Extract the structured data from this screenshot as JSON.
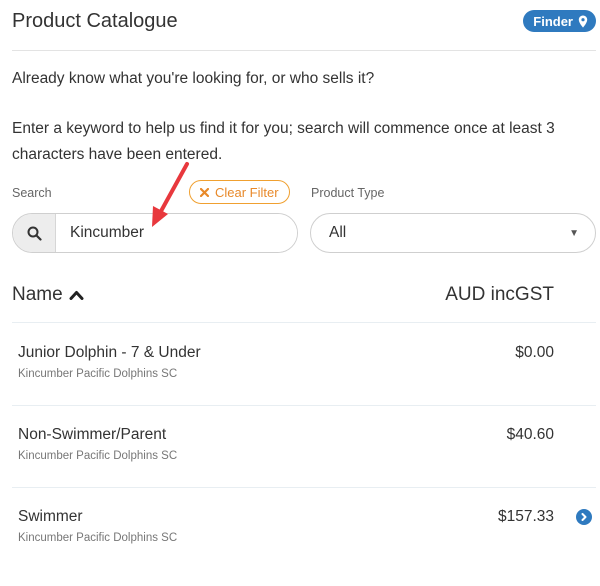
{
  "header": {
    "title": "Product Catalogue",
    "badge_label": "Finder",
    "badge_icon": "map-marker-icon"
  },
  "intro": {
    "line1": "Already know what you're looking for, or who sells it?",
    "line2": "Enter a keyword to help us find it for you; search will commence once at least 3 characters have been entered."
  },
  "filters": {
    "search_label": "Search",
    "search_value": "Kincumber",
    "clear_filter_label": "Clear Filter",
    "product_type_label": "Product Type",
    "product_type_value": "All"
  },
  "table": {
    "col_name": "Name",
    "col_price": "AUD incGST",
    "sort": "ascending",
    "rows": [
      {
        "name": "Junior Dolphin - 7 & Under",
        "seller": "Kincumber Pacific Dolphins SC",
        "price": "$0.00"
      },
      {
        "name": "Non-Swimmer/Parent",
        "seller": "Kincumber Pacific Dolphins SC",
        "price": "$40.60"
      },
      {
        "name": "Swimmer",
        "seller": "Kincumber Pacific Dolphins SC",
        "price": "$157.33"
      }
    ]
  },
  "colors": {
    "accent": "#2f7abf",
    "clear_filter": "#e8892a",
    "annotation_arrow": "#e8383d"
  }
}
